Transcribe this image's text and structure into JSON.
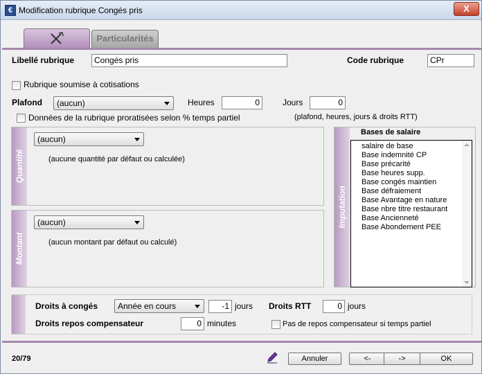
{
  "window": {
    "title": "Modification rubrique Congés pris",
    "close_label": "X",
    "app_icon_glyph": "€"
  },
  "tabs": [
    {
      "label": ""
    },
    {
      "label": "Particularités"
    }
  ],
  "form": {
    "libelle_label": "Libellé rubrique",
    "libelle_value": "Congés pris",
    "code_label": "Code rubrique",
    "code_value": "CPr",
    "cotisations_label": "Rubrique soumise à cotisations",
    "plafond_label": "Plafond",
    "plafond_value": "(aucun)",
    "heures_label": "Heures",
    "heures_value": "0",
    "jours_label": "Jours",
    "jours_value": "0",
    "prorata_label": "Données de la rubrique proratisées selon % temps partiel",
    "prorata_note": "(plafond, heures, jours & droits RTT)"
  },
  "quantite": {
    "side_label": "Quantité",
    "select_value": "(aucun)",
    "note": "(aucune quantité par défaut ou calculée)"
  },
  "montant": {
    "side_label": "Montant",
    "select_value": "(aucun)",
    "note": "(aucun montant par défaut ou calculé)"
  },
  "imputation": {
    "side_label": "Imputation",
    "header": "Bases de salaire",
    "items": [
      "salaire de base",
      "Base indemnité CP",
      "Base précarité",
      "Base heures supp.",
      "Base congés maintien",
      "Base défraiement",
      "Base Avantage en nature",
      "Base nbre titre restaurant",
      "Base Ancienneté",
      "Base Abondement PEE"
    ]
  },
  "droits": {
    "conges_label": "Droits à congés",
    "conges_select": "Année en cours",
    "conges_value": "-1",
    "jours_unit": "jours",
    "rtt_label": "Droits RTT",
    "rtt_value": "0",
    "rtt_unit": "jours",
    "repos_label": "Droits repos compensateur",
    "repos_value": "0",
    "repos_unit": "minutes",
    "pas_repos_label": "Pas de repos compensateur si temps partiel"
  },
  "footer": {
    "counter": "20/79",
    "annuler_label": "Annuler",
    "prev_label": "<-",
    "next_label": "->",
    "ok_label": "OK"
  },
  "colors": {
    "accent": "#a587ad",
    "title_gradient": "#c9d7ea"
  }
}
